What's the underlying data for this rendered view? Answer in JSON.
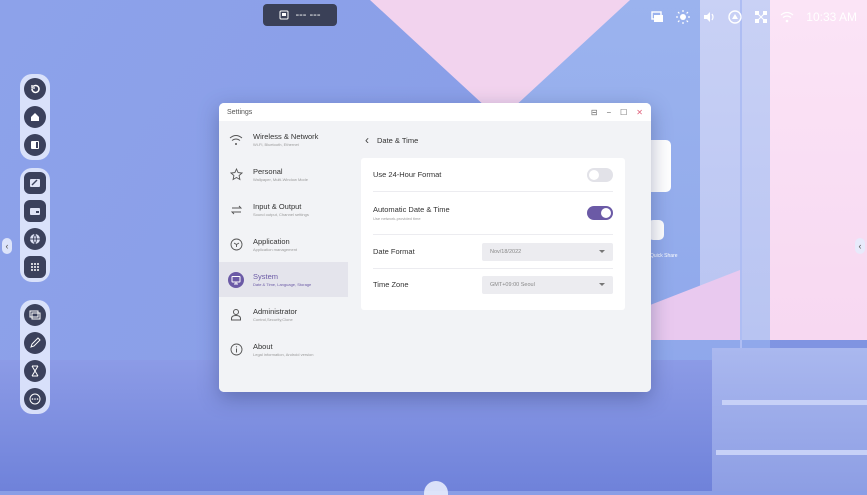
{
  "topbar": {
    "icon": "display-icon",
    "text": "--- ---"
  },
  "tray": {
    "time": "10:33 AM",
    "icons": [
      "screen-share-icon",
      "brightness-icon",
      "volume-icon",
      "cloud-icon",
      "network-icon",
      "wifi-icon"
    ]
  },
  "window": {
    "title": "Settings"
  },
  "nav": [
    {
      "label": "Wireless & Network",
      "sub": "Wi-Fi, Bluetooth, Ethernet",
      "icon": "wifi-icon"
    },
    {
      "label": "Personal",
      "sub": "Wallpaper, Multi-Window Mode",
      "icon": "star-icon"
    },
    {
      "label": "Input & Output",
      "sub": "Sound output, Channel settings",
      "icon": "swap-arrows-icon"
    },
    {
      "label": "Application",
      "sub": "Application management",
      "icon": "cube-icon"
    },
    {
      "label": "System",
      "sub": "Date & Time, Language, Storage",
      "icon": "monitor-icon",
      "active": true
    },
    {
      "label": "Administrator",
      "sub": "Control,Security,Clone",
      "icon": "user-icon"
    },
    {
      "label": "About",
      "sub": "Legal information, Android version",
      "icon": "info-icon"
    }
  ],
  "page": {
    "title": "Date & Time",
    "rows": {
      "h24": {
        "label": "Use 24-Hour Format",
        "on": false
      },
      "auto": {
        "label": "Automatic Date & Time",
        "sub": "Use network-provided time",
        "on": true
      },
      "date_format": {
        "label": "Date Format",
        "value": "Nov/18/2022"
      },
      "time_zone": {
        "label": "Time Zone",
        "value": "GMT+09:00 Seoul"
      }
    }
  },
  "desktop": {
    "widget_label": "Quick Share"
  },
  "colors": {
    "accent": "#6b5aa6",
    "toggle_off": "#e2e2e8"
  }
}
